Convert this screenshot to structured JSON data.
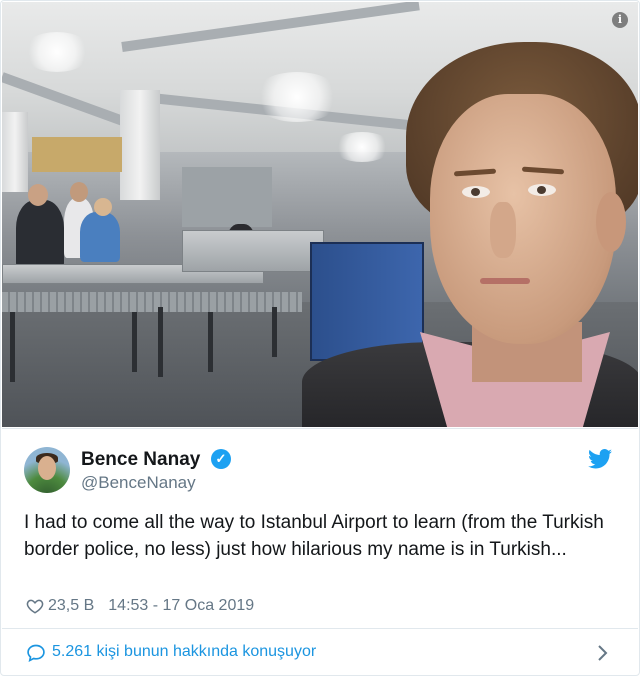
{
  "tweet": {
    "display_name": "Bence Nanay",
    "handle": "@BenceNanay",
    "text": "I had to come all the way to Istanbul Airport to learn (from the Turkish border police, no less) just how hilarious my name is in Turkish...",
    "like_count": "23,5 B",
    "timestamp": "14:53 - 17 Oca 2019",
    "conversation_label": "5.261 kişi bunun hakkında konuşuyor"
  },
  "icons": {
    "info": "info-icon",
    "verified": "verified-badge-icon",
    "twitter": "twitter-bird-icon",
    "heart": "heart-icon",
    "bubble": "speech-bubble-icon",
    "chevron": "chevron-right-icon"
  },
  "colors": {
    "twitter_blue": "#1da1f2",
    "link_blue": "#1b95e0",
    "secondary_text": "#657786",
    "border": "#e1e8ed"
  }
}
